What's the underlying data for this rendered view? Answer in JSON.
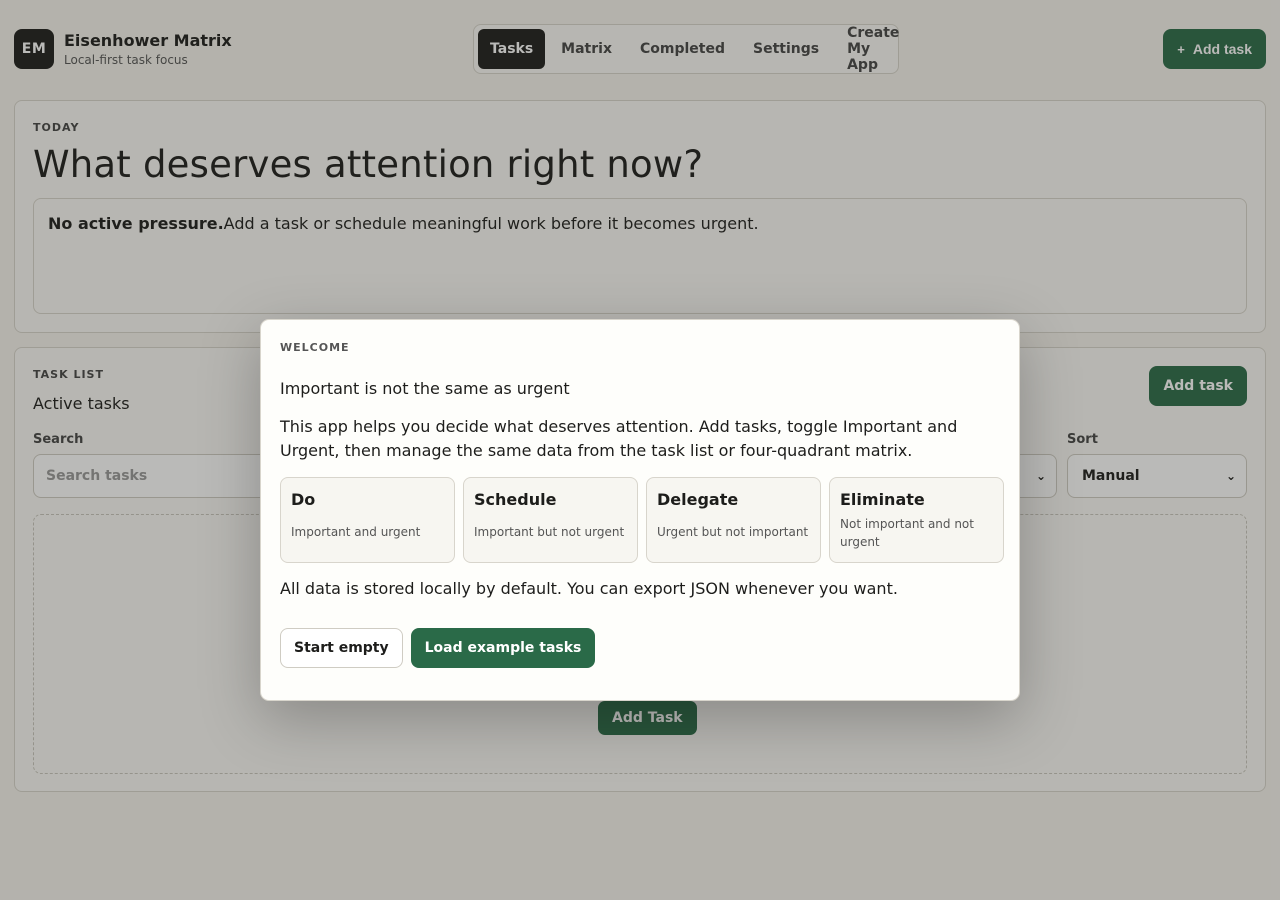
{
  "header": {
    "logo": "EM",
    "title": "Eisenhower Matrix",
    "subtitle": "Local-first task focus",
    "add_label": "Add task",
    "add_icon": "+"
  },
  "nav": [
    {
      "label": "Tasks",
      "active": true
    },
    {
      "label": "Matrix"
    },
    {
      "label": "Completed"
    },
    {
      "label": "Settings"
    },
    {
      "label": "Create My App"
    }
  ],
  "today": {
    "eyebrow": "TODAY",
    "title": "What deserves attention right now?",
    "pressure_bold": "No active pressure.",
    "pressure_text": "Add a task or schedule meaningful work before it becomes urgent."
  },
  "tasklist": {
    "eyebrow": "TASK LIST",
    "subtitle": "Active tasks",
    "add_label": "Add task",
    "search_label": "Search",
    "search_placeholder": "Search tasks",
    "sort_label": "Sort",
    "sort_value": "Manual",
    "empty_add_label": "Add Task"
  },
  "modal": {
    "eyebrow": "WELCOME",
    "title": "Important is not the same as urgent",
    "description": "This app helps you decide what deserves attention. Add tasks, toggle Important and Urgent, then manage the same data from the task list or four-quadrant matrix.",
    "quadrants": [
      {
        "title": "Do",
        "desc": "Important and urgent"
      },
      {
        "title": "Schedule",
        "desc": "Important but not urgent"
      },
      {
        "title": "Delegate",
        "desc": "Urgent but not important"
      },
      {
        "title": "Eliminate",
        "desc": "Not important and not urgent"
      }
    ],
    "note": "All data is stored locally by default. You can export JSON whenever you want.",
    "start_empty_label": "Start empty",
    "load_examples_label": "Load example tasks"
  },
  "colors": {
    "accent": "#2a6a48",
    "dark": "#1d1d1b"
  }
}
